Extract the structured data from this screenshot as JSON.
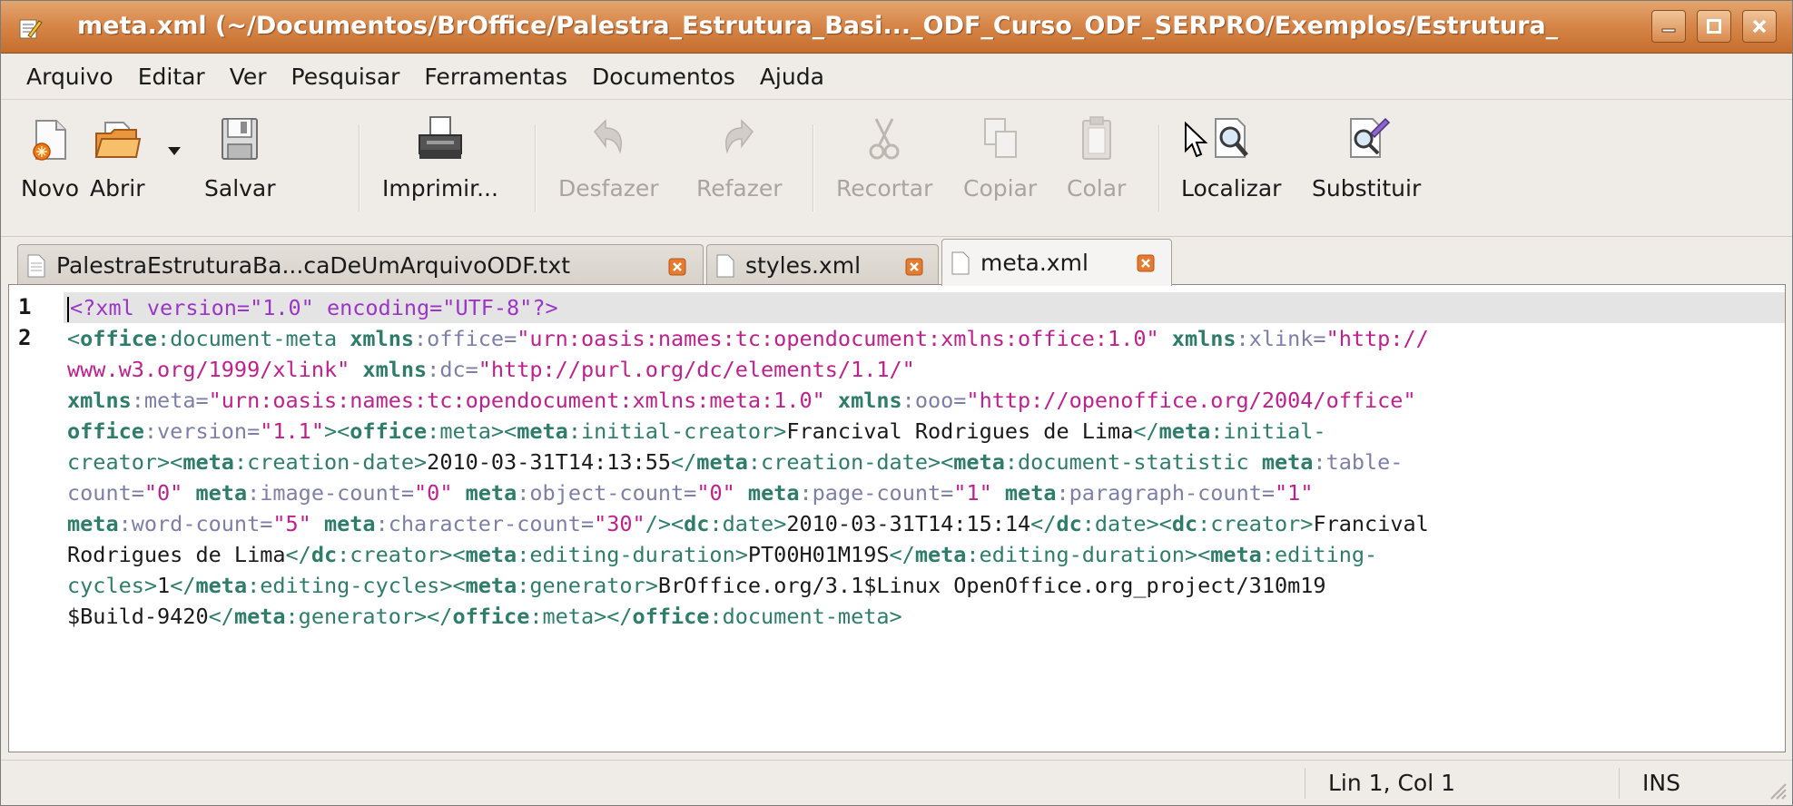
{
  "window": {
    "title": "meta.xml (~/Documentos/BrOffice/Palestra_Estrutura_Basi..._ODF_Curso_ODF_SERPRO/Exemplos/Estrutura_"
  },
  "menu": [
    "Arquivo",
    "Editar",
    "Ver",
    "Pesquisar",
    "Ferramentas",
    "Documentos",
    "Ajuda"
  ],
  "toolbar": {
    "new": "Novo",
    "open": "Abrir",
    "save": "Salvar",
    "print": "Imprimir...",
    "undo": "Desfazer",
    "redo": "Refazer",
    "cut": "Recortar",
    "copy": "Copiar",
    "paste": "Colar",
    "find": "Localizar",
    "replace": "Substituir"
  },
  "tabs": [
    {
      "label": "PalestraEstruturaBa...caDeUmArquivoODF.txt"
    },
    {
      "label": "styles.xml"
    },
    {
      "label": "meta.xml"
    }
  ],
  "editor": {
    "line_numbers": [
      "1",
      "2"
    ],
    "lines": [
      [
        [
          "pi",
          "<?xml version=\"1.0\" encoding=\"UTF-8\"?>"
        ]
      ],
      [
        [
          "lp",
          "<"
        ],
        [
          "ns",
          "office"
        ],
        [
          "lp",
          ":document-meta "
        ],
        [
          "ns",
          "xmlns"
        ],
        [
          "at",
          ":office="
        ],
        [
          "st",
          "\"urn:oasis:names:tc:opendocument:xmlns:office:1.0\""
        ],
        [
          "tx",
          " "
        ],
        [
          "ns",
          "xmlns"
        ],
        [
          "at",
          ":xlink="
        ],
        [
          "st",
          "\"http://"
        ]
      ],
      [
        [
          "st",
          "www.w3.org/1999/xlink\""
        ],
        [
          "tx",
          " "
        ],
        [
          "ns",
          "xmlns"
        ],
        [
          "at",
          ":dc="
        ],
        [
          "st",
          "\"http://purl.org/dc/elements/1.1/\""
        ]
      ],
      [
        [
          "ns",
          "xmlns"
        ],
        [
          "at",
          ":meta="
        ],
        [
          "st",
          "\"urn:oasis:names:tc:opendocument:xmlns:meta:1.0\""
        ],
        [
          "tx",
          " "
        ],
        [
          "ns",
          "xmlns"
        ],
        [
          "at",
          ":ooo="
        ],
        [
          "st",
          "\"http://openoffice.org/2004/office\""
        ]
      ],
      [
        [
          "ns",
          "office"
        ],
        [
          "at",
          ":version="
        ],
        [
          "st",
          "\"1.1\""
        ],
        [
          "lp",
          "><"
        ],
        [
          "ns",
          "office"
        ],
        [
          "lp",
          ":meta><"
        ],
        [
          "ns",
          "meta"
        ],
        [
          "lp",
          ":initial-creator>"
        ],
        [
          "tx",
          "Francival Rodrigues de Lima"
        ],
        [
          "lp",
          "</"
        ],
        [
          "ns",
          "meta"
        ],
        [
          "lp",
          ":initial-"
        ]
      ],
      [
        [
          "lp",
          "creator><"
        ],
        [
          "ns",
          "meta"
        ],
        [
          "lp",
          ":creation-date>"
        ],
        [
          "tx",
          "2010-03-31T14:13:55"
        ],
        [
          "lp",
          "</"
        ],
        [
          "ns",
          "meta"
        ],
        [
          "lp",
          ":creation-date><"
        ],
        [
          "ns",
          "meta"
        ],
        [
          "lp",
          ":document-statistic "
        ],
        [
          "ns",
          "meta"
        ],
        [
          "at",
          ":table-"
        ]
      ],
      [
        [
          "at",
          "count="
        ],
        [
          "st",
          "\"0\""
        ],
        [
          "tx",
          " "
        ],
        [
          "ns",
          "meta"
        ],
        [
          "at",
          ":image-count="
        ],
        [
          "st",
          "\"0\""
        ],
        [
          "tx",
          " "
        ],
        [
          "ns",
          "meta"
        ],
        [
          "at",
          ":object-count="
        ],
        [
          "st",
          "\"0\""
        ],
        [
          "tx",
          " "
        ],
        [
          "ns",
          "meta"
        ],
        [
          "at",
          ":page-count="
        ],
        [
          "st",
          "\"1\""
        ],
        [
          "tx",
          " "
        ],
        [
          "ns",
          "meta"
        ],
        [
          "at",
          ":paragraph-count="
        ],
        [
          "st",
          "\"1\""
        ]
      ],
      [
        [
          "ns",
          "meta"
        ],
        [
          "at",
          ":word-count="
        ],
        [
          "st",
          "\"5\""
        ],
        [
          "tx",
          " "
        ],
        [
          "ns",
          "meta"
        ],
        [
          "at",
          ":character-count="
        ],
        [
          "st",
          "\"30\""
        ],
        [
          "lp",
          "/><"
        ],
        [
          "ns",
          "dc"
        ],
        [
          "lp",
          ":date>"
        ],
        [
          "tx",
          "2010-03-31T14:15:14"
        ],
        [
          "lp",
          "</"
        ],
        [
          "ns",
          "dc"
        ],
        [
          "lp",
          ":date><"
        ],
        [
          "ns",
          "dc"
        ],
        [
          "lp",
          ":creator>"
        ],
        [
          "tx",
          "Francival"
        ]
      ],
      [
        [
          "tx",
          "Rodrigues de Lima"
        ],
        [
          "lp",
          "</"
        ],
        [
          "ns",
          "dc"
        ],
        [
          "lp",
          ":creator><"
        ],
        [
          "ns",
          "meta"
        ],
        [
          "lp",
          ":editing-duration>"
        ],
        [
          "tx",
          "PT00H01M19S"
        ],
        [
          "lp",
          "</"
        ],
        [
          "ns",
          "meta"
        ],
        [
          "lp",
          ":editing-duration><"
        ],
        [
          "ns",
          "meta"
        ],
        [
          "lp",
          ":editing-"
        ]
      ],
      [
        [
          "lp",
          "cycles>"
        ],
        [
          "tx",
          "1"
        ],
        [
          "lp",
          "</"
        ],
        [
          "ns",
          "meta"
        ],
        [
          "lp",
          ":editing-cycles><"
        ],
        [
          "ns",
          "meta"
        ],
        [
          "lp",
          ":generator>"
        ],
        [
          "tx",
          "BrOffice.org/3.1$Linux OpenOffice.org_project/310m19"
        ]
      ],
      [
        [
          "tx",
          "$Build-9420"
        ],
        [
          "lp",
          "</"
        ],
        [
          "ns",
          "meta"
        ],
        [
          "lp",
          ":generator></"
        ],
        [
          "ns",
          "office"
        ],
        [
          "lp",
          ":meta></"
        ],
        [
          "ns",
          "office"
        ],
        [
          "lp",
          ":document-meta>"
        ]
      ]
    ]
  },
  "status": {
    "position": "Lin 1, Col 1",
    "mode": "INS"
  }
}
